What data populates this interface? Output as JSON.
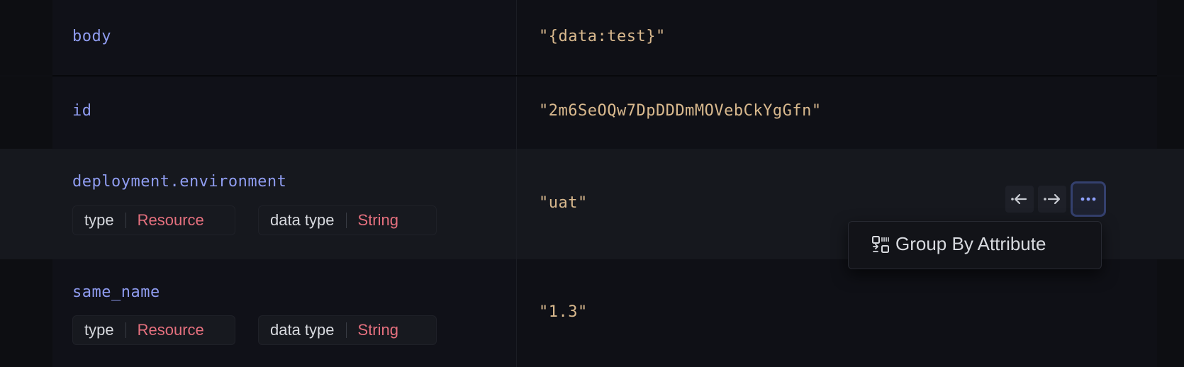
{
  "rows": [
    {
      "key": "body",
      "value": "\"{data:test}\""
    },
    {
      "key": "id",
      "value": "\"2m6SeOQw7DpDDDmMOVebCkYgGfn\""
    },
    {
      "key": "deployment.environment",
      "value": "\"uat\"",
      "type_label": "type",
      "type_value": "Resource",
      "data_type_label": "data type",
      "data_type_value": "String"
    },
    {
      "key": "same_name",
      "value": "\"1.3\"",
      "type_label": "type",
      "type_value": "Resource",
      "data_type_label": "data type",
      "data_type_value": "String"
    }
  ],
  "row_actions": {
    "icons": [
      "arrow-left-icon",
      "arrow-right-icon",
      "more-icon"
    ]
  },
  "context_menu": {
    "items": [
      {
        "label": "Group By Attribute",
        "icon": "group-by-icon"
      }
    ]
  },
  "colors": {
    "key": "#8f9cf0",
    "value": "#d9b98e",
    "chip_value": "#e5707e",
    "accent": "#8ea0ff"
  }
}
